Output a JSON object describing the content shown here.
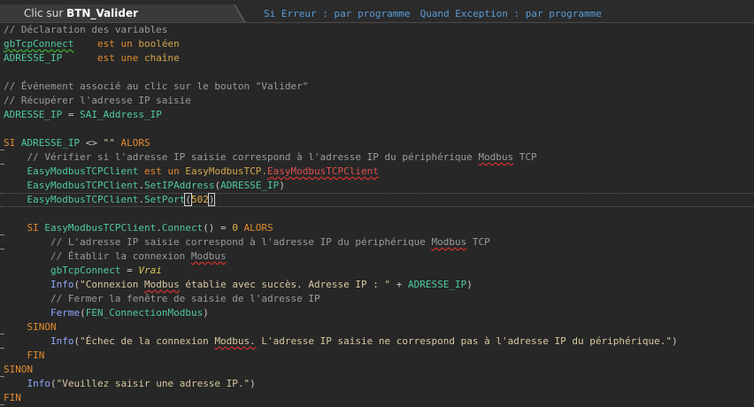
{
  "editor": {
    "tab_prefix": "Clic sur ",
    "tab_name": "BTN_Valider",
    "error_mode": "Si Erreur : par programme",
    "exception_mode": "Quand Exception : par programme"
  },
  "code_lines": [
    [
      [
        "// Déclaration des variables",
        "cmt"
      ]
    ],
    [
      [
        "gbTcpConnect",
        "var",
        "sq-g"
      ],
      [
        "    ",
        "txt"
      ],
      [
        "est un ",
        "kw"
      ],
      [
        "booléen",
        "typ"
      ]
    ],
    [
      [
        "ADRESSE_IP",
        "var"
      ],
      [
        "      ",
        "txt"
      ],
      [
        "est une ",
        "kw"
      ],
      [
        "chaîne",
        "typ"
      ]
    ],
    [],
    [
      [
        "// Événement associé au clic sur le bouton \"Valider\"",
        "cmt"
      ]
    ],
    [
      [
        "// Récupérer l'adresse IP saisie",
        "cmt"
      ]
    ],
    [
      [
        "ADRESSE_IP",
        "var"
      ],
      [
        " = ",
        "txt"
      ],
      [
        "SAI_Address_IP",
        "var"
      ]
    ],
    [],
    [
      [
        "SI ",
        "kw"
      ],
      [
        "ADRESSE_IP",
        "var"
      ],
      [
        " <> ",
        "txt"
      ],
      [
        "\"\"",
        "str"
      ],
      [
        " ALORS",
        "kw"
      ]
    ],
    [
      [
        "    // Vérifier si l'adresse IP saisie correspond à l'adresse IP du périphérique ",
        "cmt"
      ],
      [
        "Modbus",
        "cmt",
        "sq"
      ],
      [
        " TCP",
        "cmt"
      ]
    ],
    [
      [
        "    ",
        "txt"
      ],
      [
        "EasyModbusTCPClient",
        "var"
      ],
      [
        " est un ",
        "kw"
      ],
      [
        "EasyModbusTCP.",
        "typ"
      ],
      [
        "EasyModbusTCPClient",
        "err",
        "sq"
      ]
    ],
    [
      [
        "    ",
        "txt"
      ],
      [
        "EasyModbusTCPClient",
        "var"
      ],
      [
        ".",
        "txt"
      ],
      [
        "SetIPAddress",
        "var"
      ],
      [
        "(",
        "txt"
      ],
      [
        "ADRESSE_IP",
        "var"
      ],
      [
        ")",
        "txt"
      ]
    ],
    [
      [
        "    ",
        "txt"
      ],
      [
        "EasyModbusTCPClient",
        "var"
      ],
      [
        ".",
        "txt"
      ],
      [
        "SetPort",
        "var"
      ],
      [
        "(",
        "txt",
        "caret"
      ],
      [
        "502",
        "num"
      ],
      [
        ")",
        "txt",
        "caret"
      ]
    ],
    [],
    [
      [
        "    SI ",
        "kw"
      ],
      [
        "EasyModbusTCPClient",
        "var"
      ],
      [
        ".",
        "txt"
      ],
      [
        "Connect",
        "var"
      ],
      [
        "() = ",
        "txt"
      ],
      [
        "0",
        "num"
      ],
      [
        " ALORS",
        "kw"
      ]
    ],
    [
      [
        "        // L'adresse IP saisie correspond à l'adresse IP du périphérique ",
        "cmt"
      ],
      [
        "Modbus",
        "cmt",
        "sq"
      ],
      [
        " TCP",
        "cmt"
      ]
    ],
    [
      [
        "        // Établir la connexion ",
        "cmt"
      ],
      [
        "Modbus",
        "cmt",
        "sq"
      ]
    ],
    [
      [
        "        ",
        "txt"
      ],
      [
        "gbTcpConnect",
        "var"
      ],
      [
        " = ",
        "txt"
      ],
      [
        "Vrai",
        "bool"
      ]
    ],
    [
      [
        "        ",
        "txt"
      ],
      [
        "Info",
        "fn"
      ],
      [
        "(",
        "txt"
      ],
      [
        "\"Connexion ",
        "str"
      ],
      [
        "Modbus",
        "str",
        "sq"
      ],
      [
        " établie avec succès. Adresse IP : \"",
        "str"
      ],
      [
        " + ",
        "txt"
      ],
      [
        "ADRESSE_IP",
        "var"
      ],
      [
        ")",
        "txt"
      ]
    ],
    [
      [
        "        // Fermer la fenêtre de saisie de l'adresse IP",
        "cmt"
      ]
    ],
    [
      [
        "        ",
        "txt"
      ],
      [
        "Ferme",
        "fn"
      ],
      [
        "(",
        "txt"
      ],
      [
        "FEN_ConnectionModbus",
        "var"
      ],
      [
        ")",
        "txt"
      ]
    ],
    [
      [
        "    SINON",
        "kw"
      ]
    ],
    [
      [
        "        ",
        "txt"
      ],
      [
        "Info",
        "fn"
      ],
      [
        "(",
        "txt"
      ],
      [
        "\"Échec de la connexion ",
        "str"
      ],
      [
        "Modbus.",
        "str",
        "sq"
      ],
      [
        " L'adresse IP saisie ne correspond pas à l'adresse IP du périphérique.\"",
        "str"
      ],
      [
        ")",
        "txt"
      ]
    ],
    [
      [
        "    FIN",
        "kw"
      ]
    ],
    [
      [
        "SINON",
        "kw"
      ]
    ],
    [
      [
        "    ",
        "txt"
      ],
      [
        "Info",
        "fn"
      ],
      [
        "(",
        "txt"
      ],
      [
        "\"Veuillez saisir une adresse IP.\"",
        "str"
      ],
      [
        ")",
        "txt"
      ]
    ],
    [
      [
        "FIN",
        "kw"
      ]
    ]
  ]
}
